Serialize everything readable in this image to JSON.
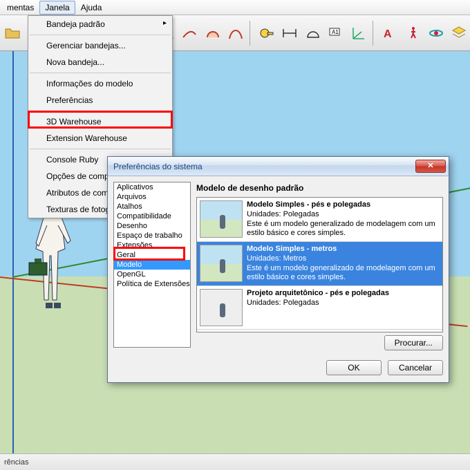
{
  "menubar": {
    "items": [
      "mentas",
      "Janela",
      "Ajuda"
    ],
    "active_index": 1
  },
  "dropdown": {
    "items": [
      {
        "label": "Bandeja padrão",
        "arrow": true
      },
      {
        "sep": true
      },
      {
        "label": "Gerenciar bandejas..."
      },
      {
        "label": "Nova bandeja..."
      },
      {
        "sep": true
      },
      {
        "label": "Informações do modelo"
      },
      {
        "label": "Preferências"
      },
      {
        "sep": true
      },
      {
        "label": "3D Warehouse"
      },
      {
        "label": "Extension Warehouse"
      },
      {
        "sep": true
      },
      {
        "label": "Console Ruby"
      },
      {
        "label": "Opções de componentes"
      },
      {
        "label": "Atributos de componentes"
      },
      {
        "label": "Texturas de fotografia"
      }
    ]
  },
  "dialog": {
    "title": "Preferências do sistema",
    "categories": [
      "Aplicativos",
      "Arquivos",
      "Atalhos",
      "Compatibilidade",
      "Desenho",
      "Espaço de trabalho",
      "Extensões",
      "Geral",
      "Modelo",
      "OpenGL",
      "Política de Extensões"
    ],
    "selected_category_index": 8,
    "right_title": "Modelo de desenho padrão",
    "templates": [
      {
        "title": "Modelo Simples - pés e polegadas",
        "units": "Unidades: Polegadas",
        "desc": "Este é um modelo generalizado de modelagem com um estilo básico e cores simples.",
        "selected": false
      },
      {
        "title": "Modelo Simples - metros",
        "units": "Unidades: Metros",
        "desc": "Este é um modelo generalizado de modelagem com um estilo básico e cores simples.",
        "selected": true
      },
      {
        "title": "Projeto arquitetônico - pés e polegadas",
        "units": "Unidades: Polegadas",
        "desc": "",
        "selected": false
      }
    ],
    "browse": "Procurar...",
    "ok": "OK",
    "cancel": "Cancelar"
  },
  "status": "rências"
}
